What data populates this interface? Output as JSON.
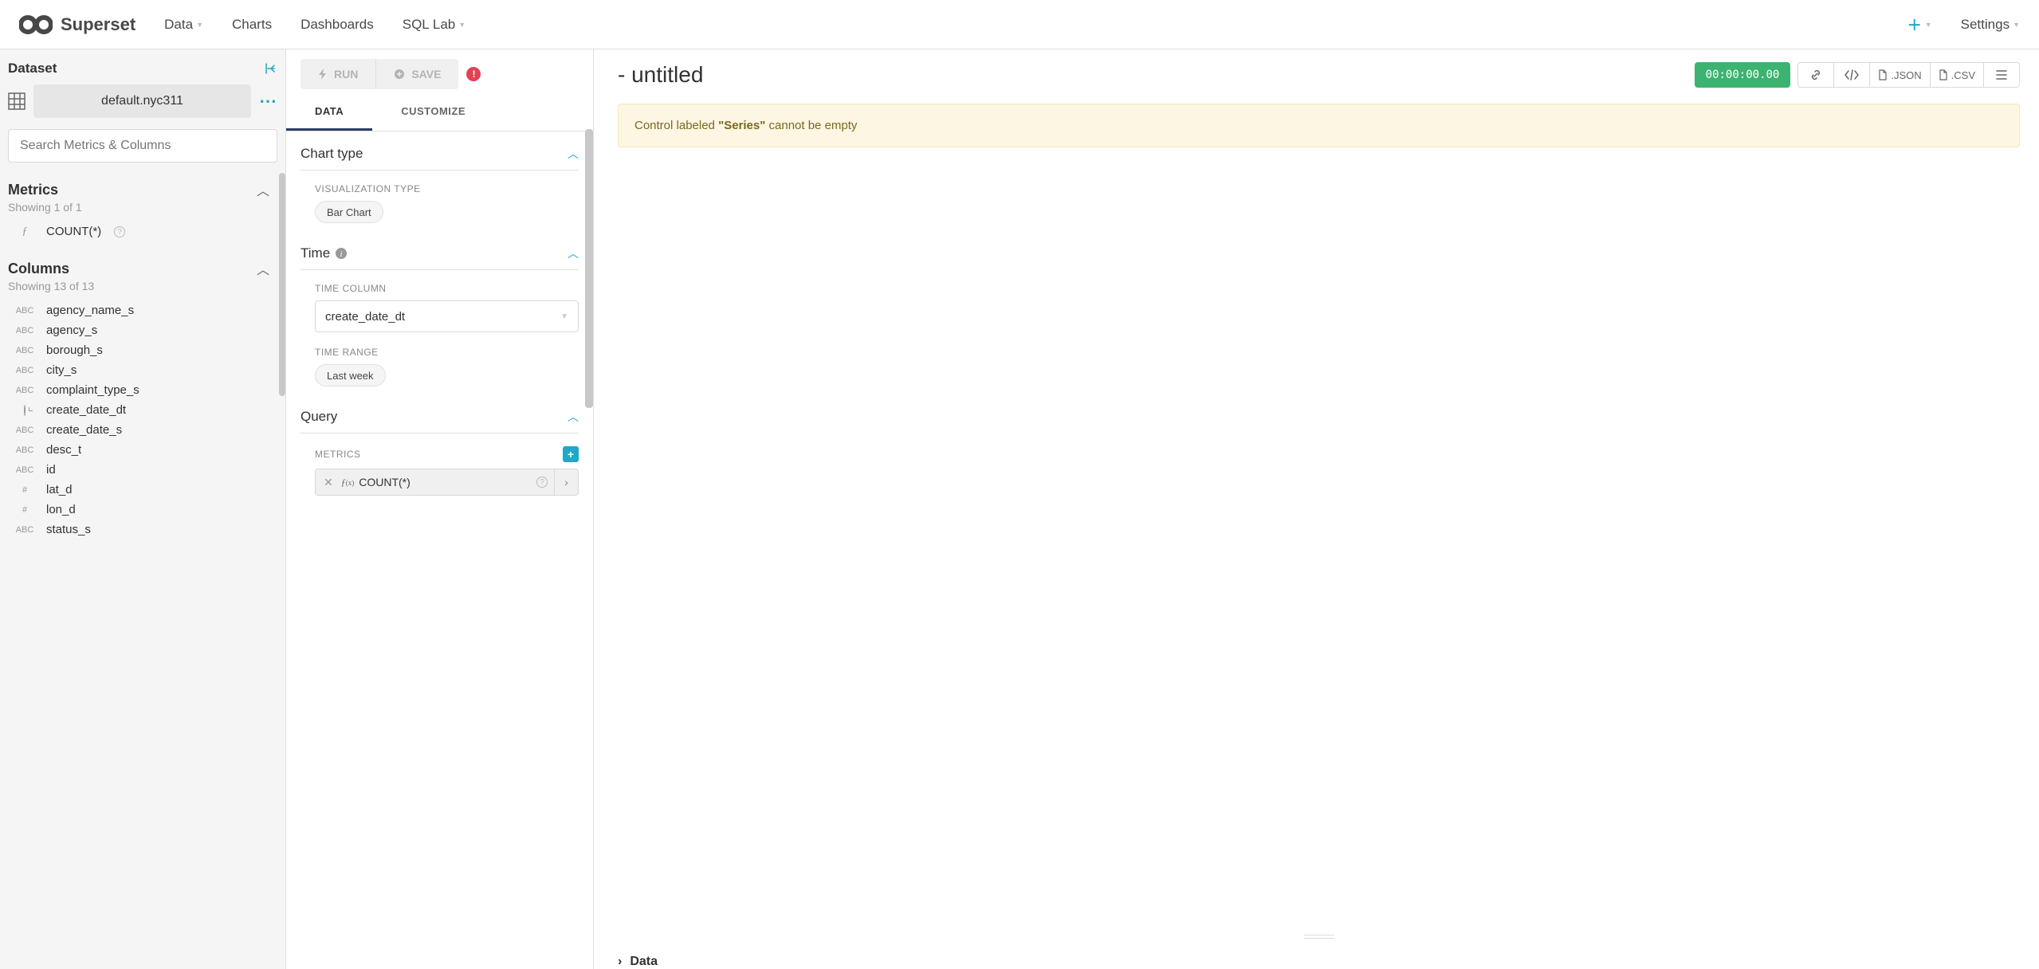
{
  "brand": "Superset",
  "nav": {
    "data": "Data",
    "charts": "Charts",
    "dashboards": "Dashboards",
    "sqllab": "SQL Lab",
    "settings": "Settings"
  },
  "sidebar": {
    "dataset_label": "Dataset",
    "dataset_name": "default.nyc311",
    "search_placeholder": "Search Metrics & Columns",
    "metrics_label": "Metrics",
    "metrics_count": "Showing 1 of 1",
    "metrics": [
      {
        "type": "f",
        "name": "COUNT(*)"
      }
    ],
    "columns_label": "Columns",
    "columns_count": "Showing 13 of 13",
    "columns": [
      {
        "type": "ABC",
        "name": "agency_name_s"
      },
      {
        "type": "ABC",
        "name": "agency_s"
      },
      {
        "type": "ABC",
        "name": "borough_s"
      },
      {
        "type": "ABC",
        "name": "city_s"
      },
      {
        "type": "ABC",
        "name": "complaint_type_s"
      },
      {
        "type": "clock",
        "name": "create_date_dt"
      },
      {
        "type": "ABC",
        "name": "create_date_s"
      },
      {
        "type": "ABC",
        "name": "desc_t"
      },
      {
        "type": "ABC",
        "name": "id"
      },
      {
        "type": "#",
        "name": "lat_d"
      },
      {
        "type": "#",
        "name": "lon_d"
      },
      {
        "type": "ABC",
        "name": "status_s"
      }
    ]
  },
  "controls": {
    "run": "RUN",
    "save": "SAVE",
    "tab_data": "DATA",
    "tab_customize": "CUSTOMIZE",
    "chart_type_section": "Chart type",
    "viz_type_label": "VISUALIZATION TYPE",
    "viz_type_value": "Bar Chart",
    "time_section": "Time",
    "time_column_label": "TIME COLUMN",
    "time_column_value": "create_date_dt",
    "time_range_label": "TIME RANGE",
    "time_range_value": "Last week",
    "query_section": "Query",
    "metrics_label": "METRICS",
    "metric_value": "COUNT(*)"
  },
  "chart": {
    "title": "- untitled",
    "timer": "00:00:00.00",
    "export_json": ".JSON",
    "export_csv": ".CSV",
    "alert_prefix": "Control labeled ",
    "alert_bold": "\"Series\"",
    "alert_suffix": " cannot be empty",
    "data_footer": "Data"
  }
}
